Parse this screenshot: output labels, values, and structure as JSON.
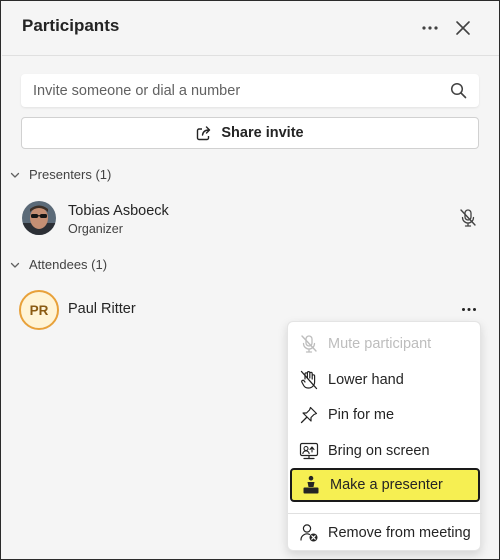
{
  "panel": {
    "title": "Participants"
  },
  "search": {
    "placeholder": "Invite someone or dial a number"
  },
  "share": {
    "label": "Share invite"
  },
  "presenters": {
    "header": "Presenters (1)",
    "people": [
      {
        "name": "Tobias Asboeck",
        "role": "Organizer"
      }
    ]
  },
  "attendees": {
    "header": "Attendees (1)",
    "people": [
      {
        "name": "Paul Ritter",
        "initials": "PR"
      }
    ]
  },
  "context_menu": {
    "items": [
      {
        "label": "Mute participant",
        "icon": "mic-off-icon",
        "disabled": true
      },
      {
        "label": "Lower hand",
        "icon": "hand-off-icon"
      },
      {
        "label": "Pin for me",
        "icon": "pin-icon"
      },
      {
        "label": "Bring on screen",
        "icon": "bring-on-screen-icon"
      },
      {
        "label": "Make a presenter",
        "icon": "presenter-icon",
        "highlighted": true
      },
      {
        "label": "Remove from meeting",
        "icon": "remove-person-icon"
      }
    ]
  },
  "colors": {
    "highlight": "#f6ef52",
    "avatar_ring": "#e8a13a",
    "background": "#f5f5f5"
  }
}
